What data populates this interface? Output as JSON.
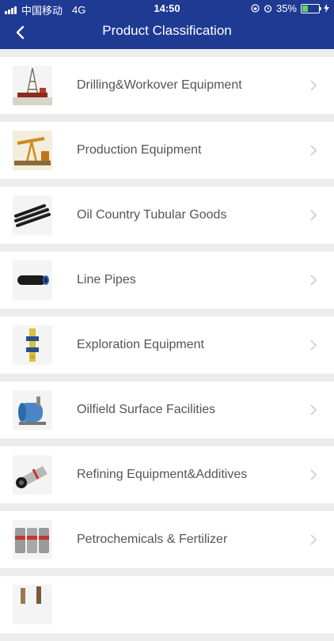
{
  "status_bar": {
    "carrier": "中国移动",
    "network": "4G",
    "time": "14:50",
    "battery_percent": "35%",
    "battery_level": 0.35
  },
  "nav": {
    "title": "Product Classification",
    "back_icon": "chevron-left-icon"
  },
  "colors": {
    "header_bg": "#1f3a93",
    "page_bg": "#ececec",
    "item_text": "#555555",
    "battery_fill": "#5fd65f"
  },
  "categories": [
    {
      "label": "Drilling&Workover Equipment",
      "icon": "drilling-rig-icon"
    },
    {
      "label": "Production Equipment",
      "icon": "pumpjack-icon"
    },
    {
      "label": "Oil Country Tubular Goods",
      "icon": "tubular-pipes-icon"
    },
    {
      "label": "Line Pipes",
      "icon": "line-pipe-icon"
    },
    {
      "label": "Exploration Equipment",
      "icon": "exploration-tool-icon"
    },
    {
      "label": "Oilfield Surface Facilities",
      "icon": "surface-facility-icon"
    },
    {
      "label": "Refining Equipment&Additives",
      "icon": "refining-equipment-icon"
    },
    {
      "label": "Petrochemicals & Fertilizer",
      "icon": "chemical-drums-icon"
    },
    {
      "label": "",
      "icon": "partial-item-icon"
    }
  ]
}
